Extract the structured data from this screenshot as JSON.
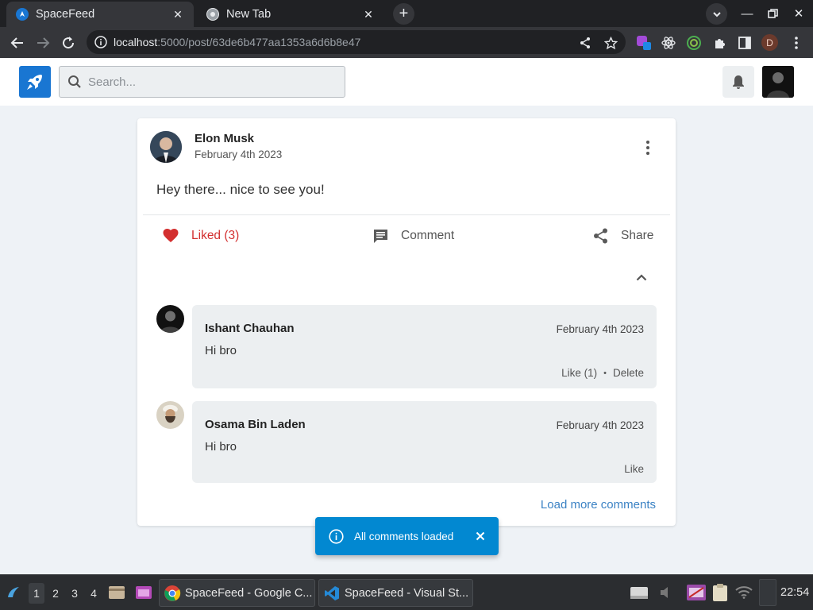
{
  "browser": {
    "tabs": [
      {
        "title": "SpaceFeed",
        "active": true
      },
      {
        "title": "New Tab",
        "active": false
      }
    ],
    "url": {
      "host": "localhost",
      "path": ":5000/post/63de6b477aa1353a6d6b8e47"
    },
    "profile_initial": "D"
  },
  "app": {
    "search_placeholder": "Search...",
    "brand_color": "#1976d2"
  },
  "post": {
    "author": "Elon Musk",
    "date": "February 4th 2023",
    "body": "Hey there... nice to see you!",
    "actions": {
      "like_label": "Liked (3)",
      "comment_label": "Comment",
      "share_label": "Share"
    },
    "comments": [
      {
        "author": "Ishant Chauhan",
        "date": "February 4th 2023",
        "text": "Hi bro",
        "like_label": "Like (1)",
        "delete_label": "Delete"
      },
      {
        "author": "Osama Bin Laden",
        "date": "February 4th 2023",
        "text": "Hi bro",
        "like_label": "Like"
      }
    ],
    "load_more_label": "Load more comments"
  },
  "snackbar": {
    "message": "All comments loaded",
    "color": "#0288d1"
  },
  "taskbar": {
    "workspaces": [
      "1",
      "2",
      "3",
      "4"
    ],
    "apps": [
      {
        "title": "SpaceFeed - Google C..."
      },
      {
        "title": "SpaceFeed - Visual St..."
      }
    ],
    "clock": "22:54"
  }
}
